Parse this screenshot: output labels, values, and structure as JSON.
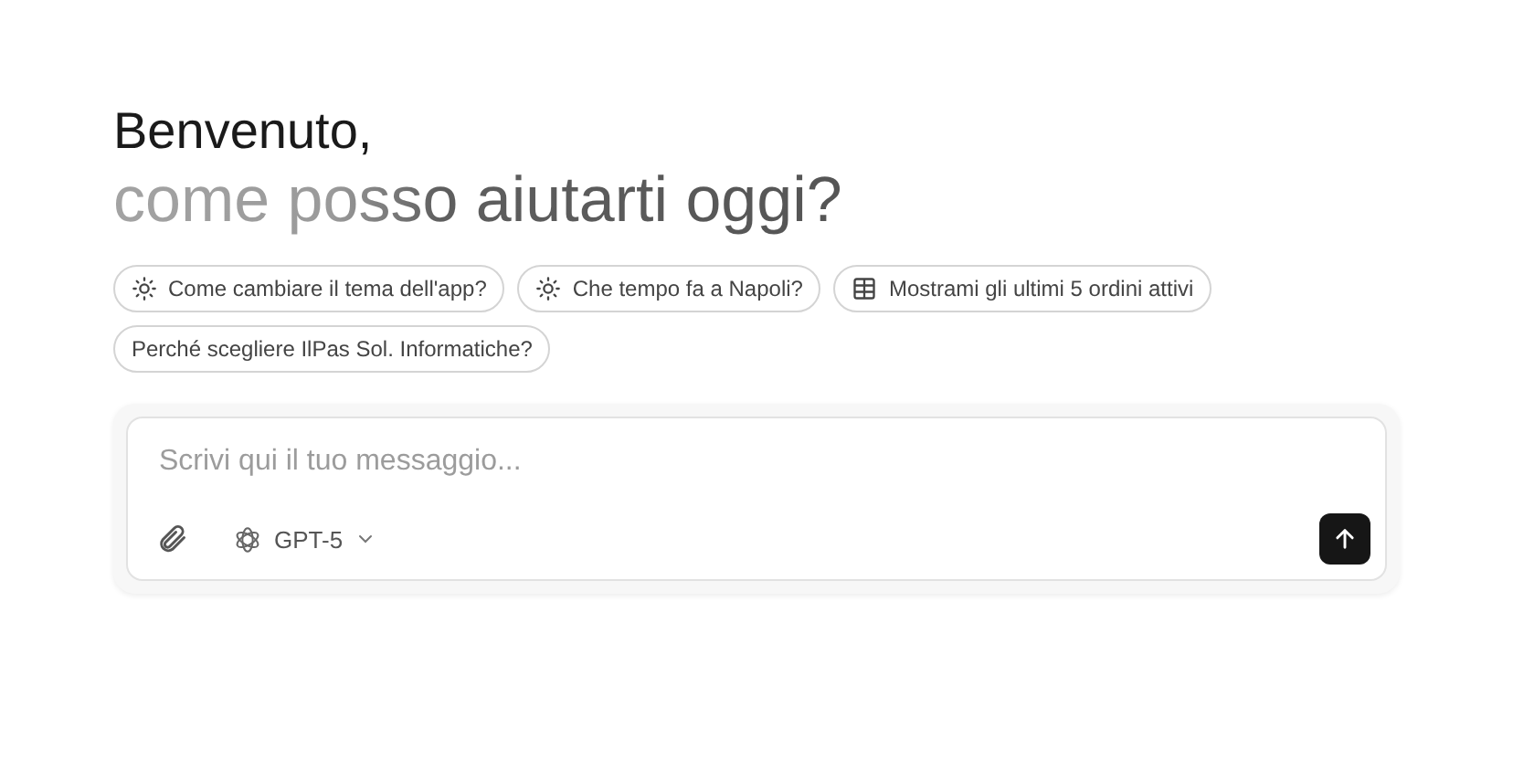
{
  "greeting": {
    "title": "Benvenuto,",
    "subtitle": "come posso aiutarti oggi?"
  },
  "suggestions": [
    {
      "label": "Come cambiare il tema dell'app?",
      "kind": "sun"
    },
    {
      "label": "Che tempo fa a Napoli?",
      "kind": "sun"
    },
    {
      "label": "Mostrami gli ultimi 5 ordini attivi",
      "kind": "table"
    },
    {
      "label": "Perché scegliere IlPas Sol. Informatiche?",
      "kind": "plain"
    }
  ],
  "composer": {
    "placeholder": "Scrivi qui il tuo messaggio...",
    "model": "GPT-5"
  }
}
